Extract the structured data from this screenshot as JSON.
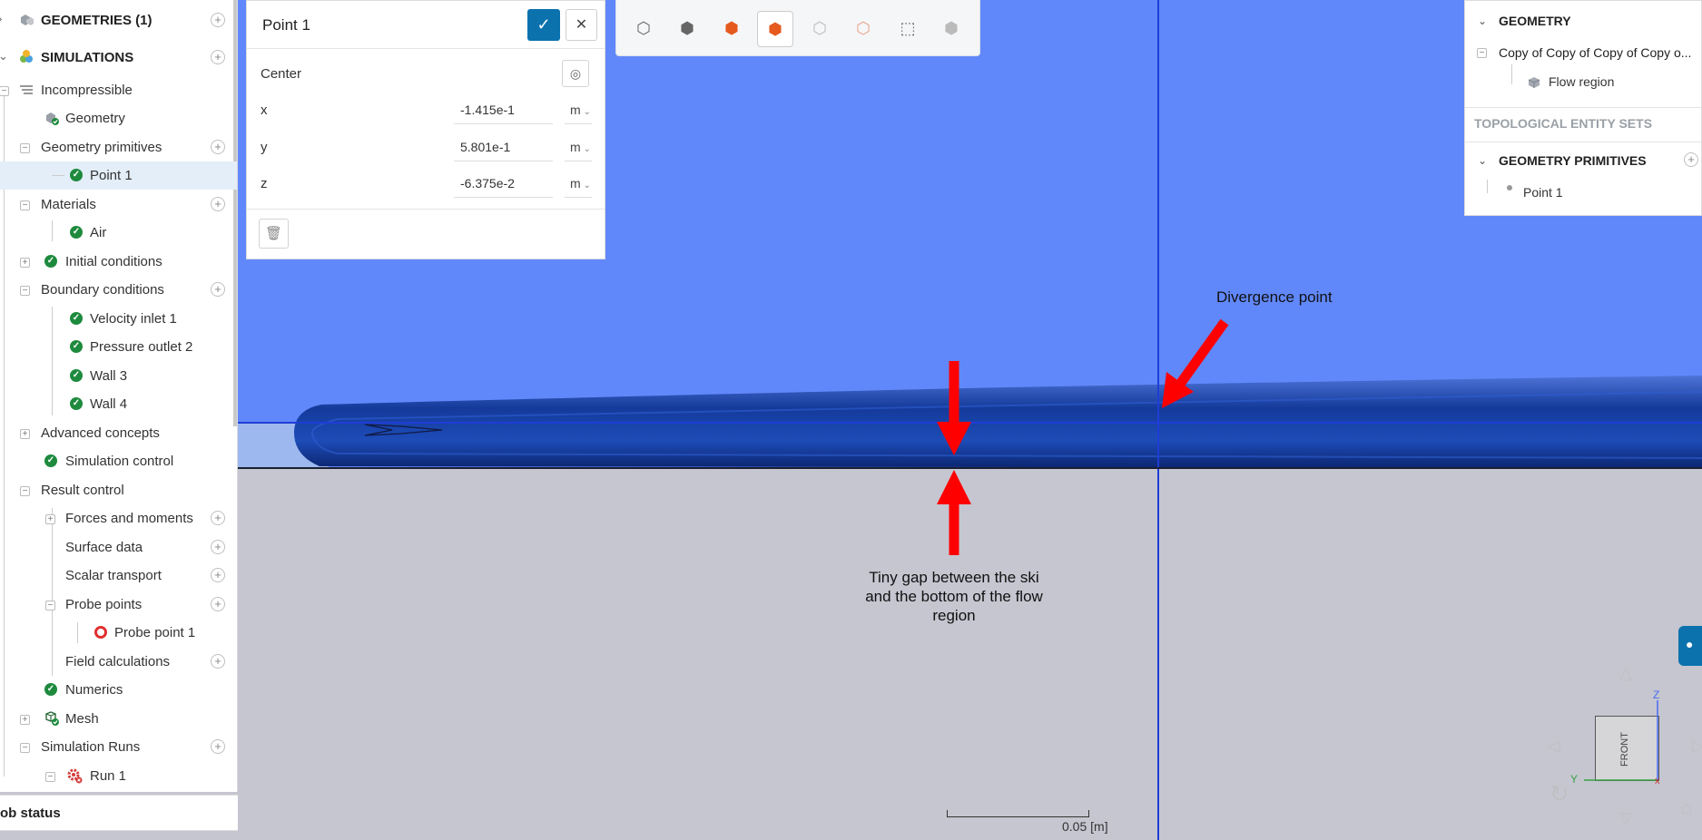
{
  "sidebar": {
    "geometries": "GEOMETRIES (1)",
    "simulations": "SIMULATIONS",
    "items": [
      {
        "label": "Incompressible"
      },
      {
        "label": "Geometry"
      },
      {
        "label": "Geometry primitives"
      },
      {
        "label": "Point 1"
      },
      {
        "label": "Materials"
      },
      {
        "label": "Air"
      },
      {
        "label": "Initial conditions"
      },
      {
        "label": "Boundary conditions"
      },
      {
        "label": "Velocity inlet 1"
      },
      {
        "label": "Pressure outlet 2"
      },
      {
        "label": "Wall 3"
      },
      {
        "label": "Wall 4"
      },
      {
        "label": "Advanced concepts"
      },
      {
        "label": "Simulation control"
      },
      {
        "label": "Result control"
      },
      {
        "label": "Forces and moments"
      },
      {
        "label": "Surface data"
      },
      {
        "label": "Scalar transport"
      },
      {
        "label": "Probe points"
      },
      {
        "label": "Probe point 1"
      },
      {
        "label": "Field calculations"
      },
      {
        "label": "Numerics"
      },
      {
        "label": "Mesh"
      },
      {
        "label": "Simulation Runs"
      },
      {
        "label": "Run 1"
      }
    ],
    "job_status": "ob status"
  },
  "point_panel": {
    "title": "Point 1",
    "center_label": "Center",
    "coords": [
      {
        "axis": "x",
        "value": "-1.415e-1",
        "unit": "m"
      },
      {
        "axis": "y",
        "value": "5.801e-1",
        "unit": "m"
      },
      {
        "axis": "z",
        "value": "-6.375e-2",
        "unit": "m"
      }
    ]
  },
  "geometry_panel": {
    "geometry_header": "GEOMETRY",
    "geometry_name": "Copy of Copy of Copy of Copy o...",
    "flow_region": "Flow region",
    "topological_sets": "TOPOLOGICAL ENTITY SETS",
    "primitives_header": "GEOMETRY PRIMITIVES",
    "primitive_item": "Point 1"
  },
  "annotations": {
    "divergence": "Divergence point",
    "gap_line1": "Tiny gap between the ski",
    "gap_line2": "and the bottom of the flow",
    "gap_line3": "region"
  },
  "scale": {
    "label": "0.05 [m]"
  },
  "view_cube": {
    "face": "FRONT",
    "axis_z": "Z",
    "axis_y": "Y"
  },
  "colors": {
    "sky": "#6188fa",
    "ground": "#c5c6d0",
    "accent": "#0b72ae",
    "annotation_arrow": "#ff0000",
    "success": "#1e8a3e"
  }
}
